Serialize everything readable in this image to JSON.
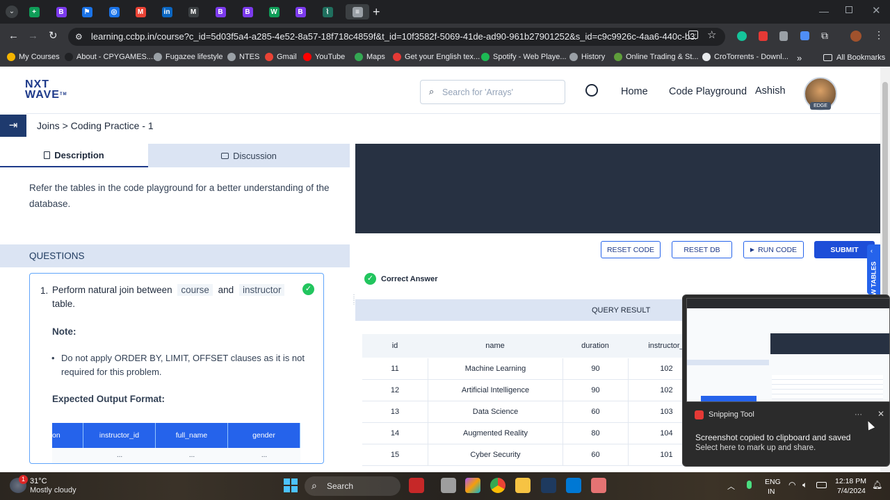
{
  "browser": {
    "url": "learning.ccbp.in/course?c_id=5d03f5a4-a285-4e52-8a57-18f718c4859f&t_id=10f3582f-5069-41de-ad90-961b27901252&s_id=c9c9926c-4aa6-440c-b325-9d6291c2...",
    "tabs": [
      {
        "name": "sheets",
        "glyph": "+",
        "color": "#0f9d58"
      },
      {
        "name": "b1",
        "glyph": "B",
        "color": "#7c3aed"
      },
      {
        "name": "flag",
        "glyph": "⚑",
        "color": "#1a73e8"
      },
      {
        "name": "shield",
        "glyph": "◎",
        "color": "#1a73e8"
      },
      {
        "name": "gmail",
        "glyph": "M",
        "color": "#ea4335"
      },
      {
        "name": "linkedin",
        "glyph": "in",
        "color": "#0a66c2"
      },
      {
        "name": "m",
        "glyph": "M",
        "color": "#3c4043"
      },
      {
        "name": "b2",
        "glyph": "B",
        "color": "#7c3aed"
      },
      {
        "name": "b3",
        "glyph": "B",
        "color": "#7c3aed"
      },
      {
        "name": "w",
        "glyph": "W",
        "color": "#0f9d58"
      },
      {
        "name": "b4",
        "glyph": "B",
        "color": "#7c3aed"
      },
      {
        "name": "chart",
        "glyph": "⌇",
        "color": "#1f6f5e"
      },
      {
        "name": "active",
        "glyph": "≡",
        "color": "#9aa0a6"
      }
    ],
    "bookmarks": [
      {
        "label": "My Courses",
        "color": "#f4b400"
      },
      {
        "label": "About - CPYGAMES....",
        "color": "#202124"
      },
      {
        "label": "Fugazee lifestyle",
        "color": "#9aa0a6"
      },
      {
        "label": "NTES",
        "color": "#9aa0a6"
      },
      {
        "label": "Gmail",
        "color": "#ea4335"
      },
      {
        "label": "YouTube",
        "color": "#ff0000"
      },
      {
        "label": "Maps",
        "color": "#34a853"
      },
      {
        "label": "Get your English tex...",
        "color": "#e53935"
      },
      {
        "label": "Spotify - Web Playe...",
        "color": "#1db954"
      },
      {
        "label": "History",
        "color": "#9aa0a6"
      },
      {
        "label": "Online Trading & St...",
        "color": "#5f9e3b"
      },
      {
        "label": "CroTorrents - Downl...",
        "color": "#e8eaed"
      }
    ],
    "all_bookmarks": "All Bookmarks",
    "more": "»"
  },
  "header": {
    "logo_line1": "NXT",
    "logo_line2": "WAVE",
    "logo_tm": "TM",
    "search_placeholder": "Search for 'Arrays'",
    "nav_home": "Home",
    "nav_playground": "Code Playground",
    "user_name": "Ashish",
    "avatar_badge": "EDGE"
  },
  "breadcrumb": "Joins > Coding Practice - 1",
  "left": {
    "tab_description": "Description",
    "tab_discussion": "Discussion",
    "intro": "Refer the tables in the code playground for a better understanding of the database.",
    "questions_heading": "QUESTIONS",
    "q_number": "1.",
    "q_text_1": "Perform natural join between",
    "q_code_1": "course",
    "q_and": "and",
    "q_code_2": "instructor",
    "q_text_2": "table.",
    "note_label": "Note:",
    "note_item": "Do not apply ORDER BY, LIMIT, OFFSET clauses as it is not required for this problem.",
    "expected_label": "Expected Output Format:",
    "expected_columns": [
      "on",
      "instructor_id",
      "full_name",
      "gender"
    ],
    "expected_row": [
      "",
      "...",
      "...",
      "..."
    ]
  },
  "right": {
    "btn_reset_code": "RESET CODE",
    "btn_reset_db": "RESET DB",
    "btn_run": "RUN CODE",
    "btn_submit": "SUBMIT",
    "view_tables": "W TABLES",
    "status": "Correct Answer",
    "query_result_title": "QUERY RESULT",
    "columns": [
      "id",
      "name",
      "duration",
      "instructor_"
    ],
    "rows": [
      [
        "11",
        "Machine Learning",
        "90",
        "102"
      ],
      [
        "12",
        "Artificial Intelligence",
        "90",
        "102"
      ],
      [
        "13",
        "Data Science",
        "60",
        "103"
      ],
      [
        "14",
        "Augmented Reality",
        "80",
        "104"
      ],
      [
        "15",
        "Cyber Security",
        "60",
        "101"
      ]
    ]
  },
  "toast": {
    "app": "Snipping Tool",
    "more": "···",
    "line1": "Screenshot copied to clipboard and saved",
    "line2": "Select here to mark up and share."
  },
  "taskbar": {
    "weather_temp": "31°C",
    "weather_desc": "Mostly cloudy",
    "weather_badge": "1",
    "search": "Search",
    "lang1": "ENG",
    "lang2": "IN",
    "time": "12:18 PM",
    "date": "7/4/2024"
  }
}
